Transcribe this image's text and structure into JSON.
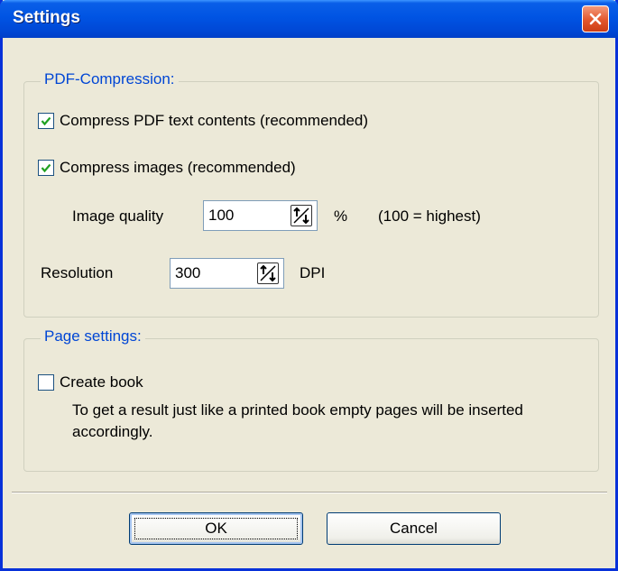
{
  "window": {
    "title": "Settings"
  },
  "pdf_compression": {
    "legend": "PDF-Compression:",
    "compress_text": {
      "label": "Compress PDF text contents (recommended)",
      "checked": true
    },
    "compress_images": {
      "label": "Compress images (recommended)",
      "checked": true
    },
    "image_quality": {
      "label": "Image quality",
      "value": "100",
      "unit": "%",
      "hint": "(100 = highest)"
    },
    "resolution": {
      "label": "Resolution",
      "value": "300",
      "unit": "DPI"
    }
  },
  "page_settings": {
    "legend": "Page settings:",
    "create_book": {
      "label": "Create book",
      "checked": false
    },
    "description": "To get a result just like a printed book empty pages will be inserted accordingly."
  },
  "buttons": {
    "ok": "OK",
    "cancel": "Cancel"
  },
  "colors": {
    "title_bar": "#0054e3",
    "legend_text": "#0046d5",
    "check_mark": "#21a121"
  },
  "icons": [
    "close-icon",
    "checkmark-icon",
    "spin-arrows-icon"
  ]
}
